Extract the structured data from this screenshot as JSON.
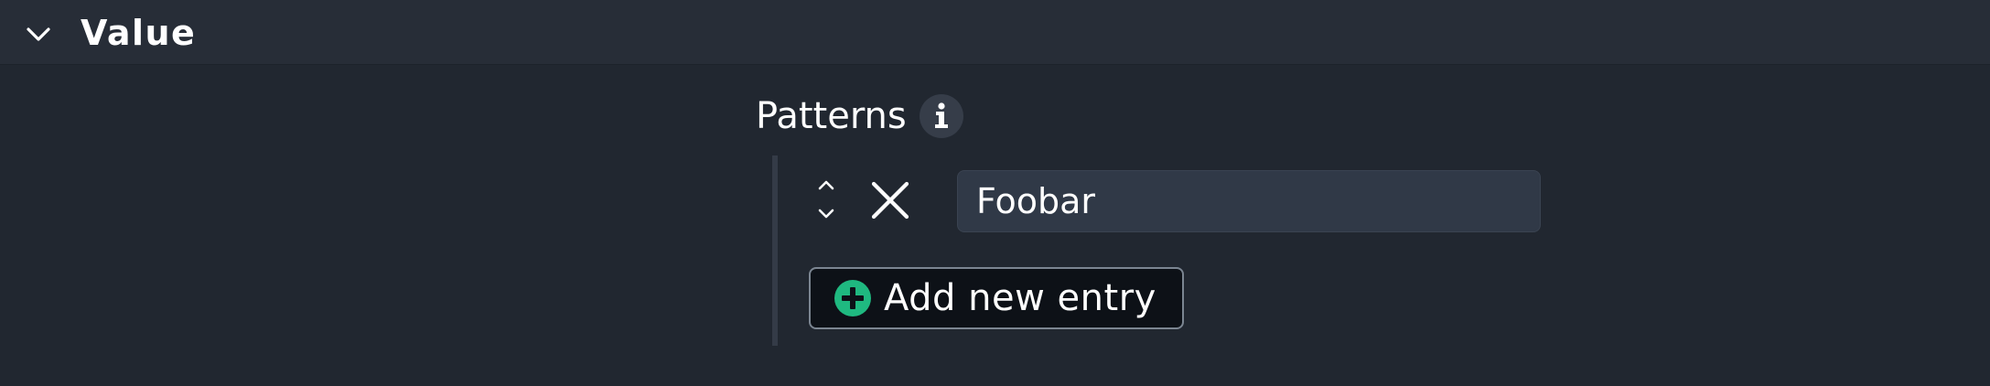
{
  "section": {
    "title": "Value",
    "toggle_icon": "chevron-down-icon"
  },
  "field": {
    "label": "Patterns",
    "info_icon": "info-icon"
  },
  "entries": [
    {
      "value": "Foobar",
      "reorder_icon": "reorder-icon",
      "remove_icon": "close-icon"
    }
  ],
  "add_button": {
    "label": "Add new entry",
    "icon": "plus-circle-icon",
    "accent_color": "#1fb980"
  },
  "colors": {
    "background": "#212730",
    "header": "#272d37",
    "input": "#303947"
  }
}
